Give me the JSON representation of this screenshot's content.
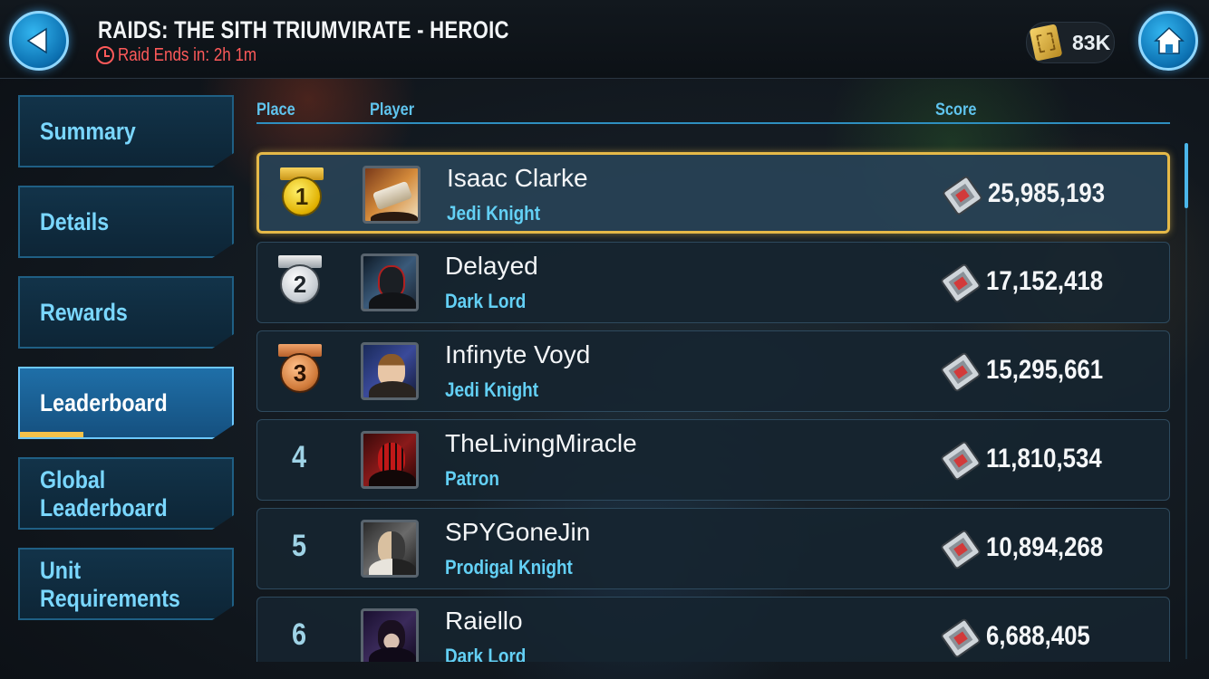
{
  "header": {
    "title": "RAIDS: THE SITH TRIUMVIRATE - HEROIC",
    "timer_text": "Raid Ends in: 2h 1m",
    "currency_amount": "83K"
  },
  "sidebar": {
    "items": [
      {
        "label": "Summary",
        "active": false
      },
      {
        "label": "Details",
        "active": false
      },
      {
        "label": "Rewards",
        "active": false
      },
      {
        "label": "Leaderboard",
        "active": true
      },
      {
        "label_line1": "Global",
        "label_line2": "Leaderboard",
        "active": false
      },
      {
        "label_line1": "Unit",
        "label_line2": "Requirements",
        "active": false
      }
    ]
  },
  "table": {
    "columns": {
      "place": "Place",
      "player": "Player",
      "score": "Score"
    },
    "rows": [
      {
        "place": "1",
        "medal": "gold",
        "name": "Isaac Clarke",
        "title": "Jedi Knight",
        "score": "25,985,193"
      },
      {
        "place": "2",
        "medal": "silver",
        "name": "Delayed",
        "title": "Dark Lord",
        "score": "17,152,418"
      },
      {
        "place": "3",
        "medal": "bronze",
        "name": "Infinyte Voyd",
        "title": "Jedi Knight",
        "score": "15,295,661"
      },
      {
        "place": "4",
        "medal": "none",
        "name": "TheLivingMiracle",
        "title": "Patron",
        "score": "11,810,534"
      },
      {
        "place": "5",
        "medal": "none",
        "name": "SPYGoneJin",
        "title": "Prodigal Knight",
        "score": "10,894,268"
      },
      {
        "place": "6",
        "medal": "none",
        "name": "Raiello",
        "title": "Dark Lord",
        "score": "6,688,405"
      }
    ]
  },
  "colors": {
    "accent": "#63d0f5",
    "gold_border": "#e5b948",
    "timer_red": "#ff5a5a"
  },
  "icons": {
    "back": "back-arrow-icon",
    "home": "home-icon",
    "currency": "raid-ticket-icon",
    "score": "raid-damage-icon",
    "timer": "clock-icon"
  }
}
